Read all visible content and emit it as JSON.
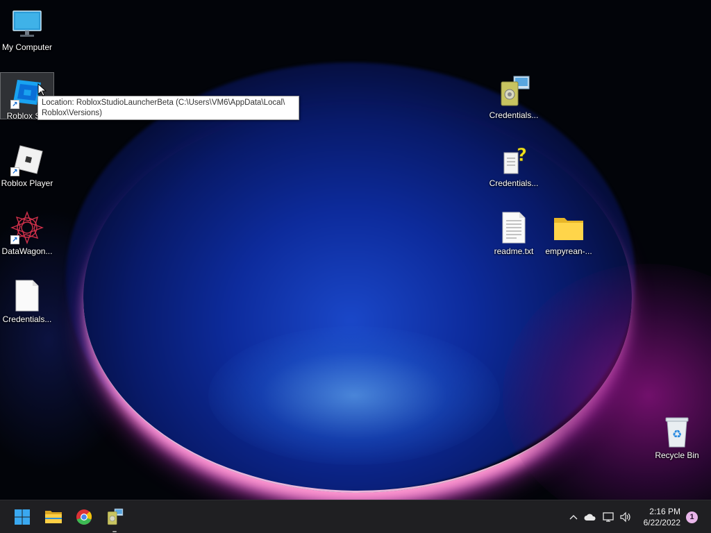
{
  "desktop": {
    "icons_left": [
      {
        "label": "My Computer",
        "icon": "monitor-icon"
      },
      {
        "label": "Roblox Stu",
        "icon": "roblox-studio-icon"
      },
      {
        "label": "Roblox Player",
        "icon": "roblox-player-icon"
      },
      {
        "label": "DataWagon...",
        "icon": "datawagon-icon"
      },
      {
        "label": "Credentials...",
        "icon": "blank-file-icon"
      }
    ],
    "icons_right": [
      {
        "label": "Credentials...",
        "icon": "credentials-app-icon"
      },
      {
        "label": "Credentials...",
        "icon": "help-file-icon"
      },
      {
        "label": "readme.txt",
        "icon": "text-file-icon"
      },
      {
        "label": "empyrean-...",
        "icon": "folder-icon"
      },
      {
        "label": "Recycle Bin",
        "icon": "recycle-bin-icon"
      }
    ]
  },
  "tooltip": {
    "line1": "Location: RobloxStudioLauncherBeta (C:\\Users\\VM6\\AppData\\Local\\",
    "line2": "Roblox\\Versions)"
  },
  "taskbar": {
    "apps": [
      "start-icon",
      "file-explorer-icon",
      "chrome-icon",
      "credentials-app-icon"
    ],
    "tray": {
      "chevron": "^",
      "time": "2:16 PM",
      "date": "6/22/2022",
      "notification_count": "1"
    }
  },
  "colors": {
    "taskbar_bg": "#1f1f22",
    "desktop_bg": "#020409",
    "accent_blue": "#1a47c8",
    "accent_pink": "#ff9ad0"
  }
}
